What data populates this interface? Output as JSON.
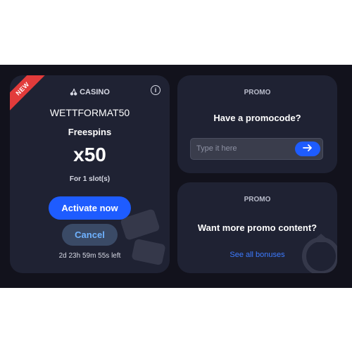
{
  "band_color": "#12121c",
  "card_color": "#1f2233",
  "accent_blue": "#1e5cff",
  "bonus_card": {
    "ribbon": "NEW",
    "category": "CASINO",
    "category_icon": "cherry-icon",
    "info_icon": "info-icon",
    "code": "WETTFORMAT50",
    "bonus_type": "Freespins",
    "amount": "x50",
    "slots_text": "For 1 slot(s)",
    "activate_label": "Activate now",
    "cancel_label": "Cancel",
    "time_left": "2d 23h 59m 55s left"
  },
  "promo_code_card": {
    "label": "PROMO",
    "question": "Have a promocode?",
    "input_placeholder": "Type it here",
    "input_value": "",
    "submit_icon": "arrow-right-icon"
  },
  "promo_content_card": {
    "label": "PROMO",
    "question": "Want more promo content?",
    "link_label": "See all bonuses"
  }
}
